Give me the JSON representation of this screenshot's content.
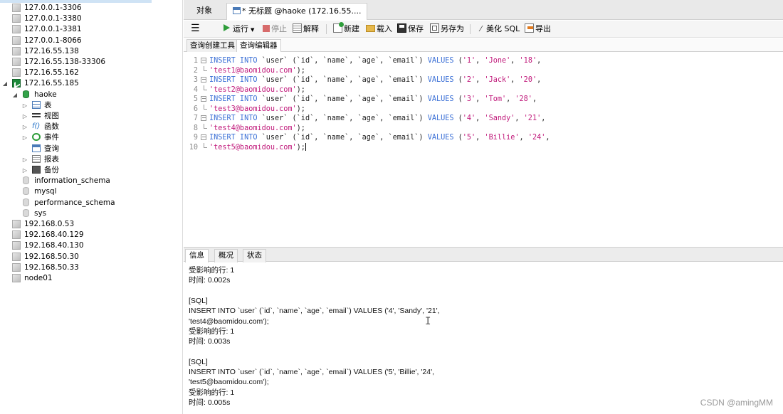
{
  "sidebar": {
    "items": [
      {
        "label": "127.0.0.1-3306",
        "indent": 0,
        "type": "conn",
        "state": "off",
        "arrow": ""
      },
      {
        "label": "127.0.0.1-3380",
        "indent": 0,
        "type": "conn",
        "state": "off",
        "arrow": ""
      },
      {
        "label": "127.0.0.1-3381",
        "indent": 0,
        "type": "conn",
        "state": "off",
        "arrow": ""
      },
      {
        "label": "127.0.0.1-8066",
        "indent": 0,
        "type": "conn",
        "state": "off",
        "arrow": ""
      },
      {
        "label": "172.16.55.138",
        "indent": 0,
        "type": "conn",
        "state": "off",
        "arrow": ""
      },
      {
        "label": "172.16.55.138-33306",
        "indent": 0,
        "type": "conn",
        "state": "off",
        "arrow": ""
      },
      {
        "label": "172.16.55.162",
        "indent": 0,
        "type": "conn",
        "state": "off",
        "arrow": ""
      },
      {
        "label": "172.16.55.185",
        "indent": 0,
        "type": "conn",
        "state": "on",
        "arrow": "open"
      },
      {
        "label": "haoke",
        "indent": 1,
        "type": "db",
        "state": "on",
        "arrow": "open"
      },
      {
        "label": "表",
        "indent": 2,
        "type": "table",
        "state": "on",
        "arrow": "closed"
      },
      {
        "label": "视图",
        "indent": 2,
        "type": "view",
        "state": "on",
        "arrow": "closed"
      },
      {
        "label": "函数",
        "indent": 2,
        "type": "func",
        "state": "on",
        "arrow": "closed"
      },
      {
        "label": "事件",
        "indent": 2,
        "type": "event",
        "state": "on",
        "arrow": "closed"
      },
      {
        "label": "查询",
        "indent": 2,
        "type": "query",
        "state": "on",
        "arrow": ""
      },
      {
        "label": "报表",
        "indent": 2,
        "type": "report",
        "state": "on",
        "arrow": "closed"
      },
      {
        "label": "备份",
        "indent": 2,
        "type": "backup",
        "state": "on",
        "arrow": "closed"
      },
      {
        "label": "information_schema",
        "indent": 1,
        "type": "db",
        "state": "off",
        "arrow": ""
      },
      {
        "label": "mysql",
        "indent": 1,
        "type": "db",
        "state": "off",
        "arrow": ""
      },
      {
        "label": "performance_schema",
        "indent": 1,
        "type": "db",
        "state": "off",
        "arrow": ""
      },
      {
        "label": "sys",
        "indent": 1,
        "type": "db",
        "state": "off",
        "arrow": ""
      },
      {
        "label": "192.168.0.53",
        "indent": 0,
        "type": "conn",
        "state": "off",
        "arrow": ""
      },
      {
        "label": "192.168.40.129",
        "indent": 0,
        "type": "conn",
        "state": "off",
        "arrow": ""
      },
      {
        "label": "192.168.40.130",
        "indent": 0,
        "type": "conn",
        "state": "off",
        "arrow": ""
      },
      {
        "label": "192.168.50.30",
        "indent": 0,
        "type": "conn",
        "state": "off",
        "arrow": ""
      },
      {
        "label": "192.168.50.33",
        "indent": 0,
        "type": "conn",
        "state": "off",
        "arrow": ""
      },
      {
        "label": "node01",
        "indent": 0,
        "type": "conn",
        "state": "off",
        "arrow": ""
      }
    ]
  },
  "tabs": {
    "objects": "对象",
    "query": "* 无标题 @haoke (172.16.55...."
  },
  "toolbar": {
    "run": "运行",
    "stop": "停止",
    "explain": "解释",
    "new": "新建",
    "load": "载入",
    "save": "保存",
    "save_as": "另存为",
    "beautify": "美化 SQL",
    "export": "导出"
  },
  "subtabs": {
    "builder": "查询创建工具",
    "editor": "查询编辑器"
  },
  "editor": {
    "lines": [
      {
        "n": "1",
        "fold": "start",
        "tokens": [
          [
            "kw",
            "INSERT INTO "
          ],
          [
            "pl",
            "`user` (`id`, `name`, `age`, `email`) "
          ],
          [
            "kw",
            "VALUES "
          ],
          [
            "pl",
            "("
          ],
          [
            "str",
            "'1'"
          ],
          [
            "pl",
            ", "
          ],
          [
            "str",
            "'Jone'"
          ],
          [
            "pl",
            ", "
          ],
          [
            "str",
            "'18'"
          ],
          [
            "pl",
            ","
          ]
        ]
      },
      {
        "n": "2",
        "fold": "end",
        "tokens": [
          [
            "str",
            "'test1@baomidou.com'"
          ],
          [
            "pl",
            ");"
          ]
        ]
      },
      {
        "n": "3",
        "fold": "start",
        "tokens": [
          [
            "kw",
            "INSERT INTO "
          ],
          [
            "pl",
            "`user` (`id`, `name`, `age`, `email`) "
          ],
          [
            "kw",
            "VALUES "
          ],
          [
            "pl",
            "("
          ],
          [
            "str",
            "'2'"
          ],
          [
            "pl",
            ", "
          ],
          [
            "str",
            "'Jack'"
          ],
          [
            "pl",
            ", "
          ],
          [
            "str",
            "'20'"
          ],
          [
            "pl",
            ","
          ]
        ]
      },
      {
        "n": "4",
        "fold": "end",
        "tokens": [
          [
            "str",
            "'test2@baomidou.com'"
          ],
          [
            "pl",
            ");"
          ]
        ]
      },
      {
        "n": "5",
        "fold": "start",
        "tokens": [
          [
            "kw",
            "INSERT INTO "
          ],
          [
            "pl",
            "`user` (`id`, `name`, `age`, `email`) "
          ],
          [
            "kw",
            "VALUES "
          ],
          [
            "pl",
            "("
          ],
          [
            "str",
            "'3'"
          ],
          [
            "pl",
            ", "
          ],
          [
            "str",
            "'Tom'"
          ],
          [
            "pl",
            ", "
          ],
          [
            "str",
            "'28'"
          ],
          [
            "pl",
            ","
          ]
        ]
      },
      {
        "n": "6",
        "fold": "end",
        "tokens": [
          [
            "str",
            "'test3@baomidou.com'"
          ],
          [
            "pl",
            ");"
          ]
        ]
      },
      {
        "n": "7",
        "fold": "start",
        "tokens": [
          [
            "kw",
            "INSERT INTO "
          ],
          [
            "pl",
            "`user` (`id`, `name`, `age`, `email`) "
          ],
          [
            "kw",
            "VALUES "
          ],
          [
            "pl",
            "("
          ],
          [
            "str",
            "'4'"
          ],
          [
            "pl",
            ", "
          ],
          [
            "str",
            "'Sandy'"
          ],
          [
            "pl",
            ", "
          ],
          [
            "str",
            "'21'"
          ],
          [
            "pl",
            ","
          ]
        ]
      },
      {
        "n": "8",
        "fold": "end",
        "tokens": [
          [
            "str",
            "'test4@baomidou.com'"
          ],
          [
            "pl",
            ");"
          ]
        ]
      },
      {
        "n": "9",
        "fold": "start",
        "tokens": [
          [
            "kw",
            "INSERT INTO "
          ],
          [
            "pl",
            "`user` (`id`, `name`, `age`, `email`) "
          ],
          [
            "kw",
            "VALUES "
          ],
          [
            "pl",
            "("
          ],
          [
            "str",
            "'5'"
          ],
          [
            "pl",
            ", "
          ],
          [
            "str",
            "'Billie'"
          ],
          [
            "pl",
            ", "
          ],
          [
            "str",
            "'24'"
          ],
          [
            "pl",
            ","
          ]
        ]
      },
      {
        "n": "10",
        "fold": "end",
        "tokens": [
          [
            "str",
            "'test5@baomidou.com'"
          ],
          [
            "pl",
            ");"
          ]
        ]
      }
    ]
  },
  "bottom_tabs": {
    "info": "信息",
    "profile": "概况",
    "status": "状态"
  },
  "output": {
    "lines": [
      "受影响的行: 1",
      "时间: 0.002s",
      "",
      "[SQL]",
      "INSERT INTO `user` (`id`, `name`, `age`, `email`) VALUES ('4', 'Sandy', '21',",
      "'test4@baomidou.com');",
      "受影响的行: 1",
      "时间: 0.003s",
      "",
      "[SQL]",
      "INSERT INTO `user` (`id`, `name`, `age`, `email`) VALUES ('5', 'Billie', '24',",
      "'test5@baomidou.com');",
      "受影响的行: 1",
      "时间: 0.005s"
    ]
  },
  "watermark": "CSDN @amingMM",
  "colors": {
    "keyword": "#3a6fd6",
    "string": "#c0187a",
    "run_green": "#2e9d3a",
    "connection_active": "#1d8a3a"
  }
}
